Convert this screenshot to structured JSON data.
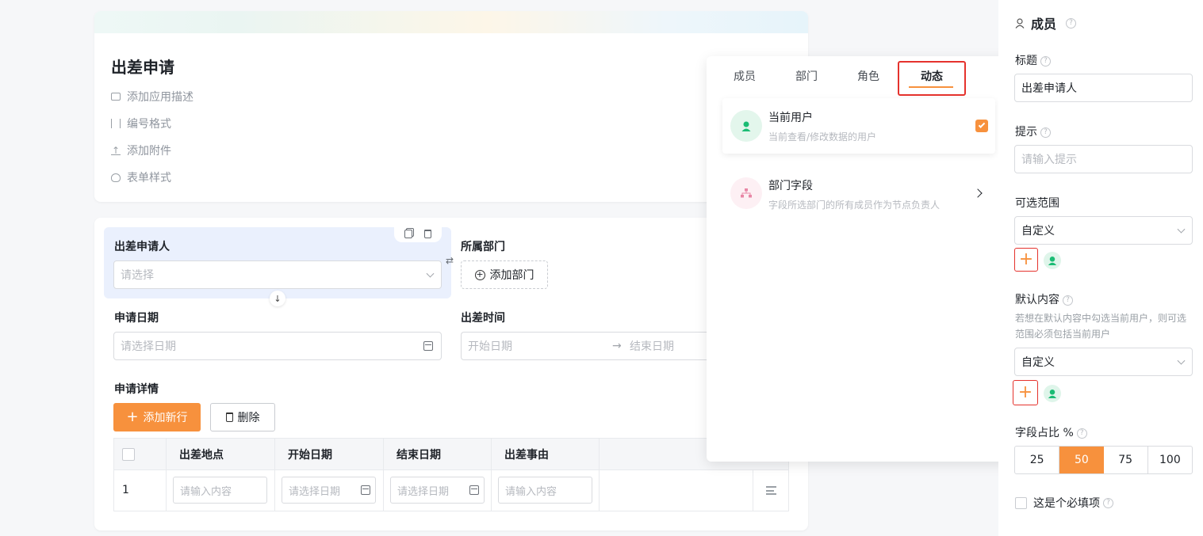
{
  "form": {
    "title": "出差申请",
    "actions": [
      {
        "icon": "comment-icon",
        "label": "添加应用描述"
      },
      {
        "icon": "number-format-icon",
        "label": "编号格式"
      },
      {
        "icon": "upload-icon",
        "label": "添加附件"
      },
      {
        "icon": "palette-icon",
        "label": "表单样式"
      }
    ]
  },
  "fields": {
    "applicant": {
      "label": "出差申请人",
      "placeholder": "请选择"
    },
    "department": {
      "label": "所属部门",
      "button": "添加部门"
    },
    "apply_date": {
      "label": "申请日期",
      "placeholder": "请选择日期"
    },
    "trip_time": {
      "label": "出差时间",
      "start_placeholder": "开始日期",
      "arrow": "→",
      "end_placeholder": "结束日期"
    },
    "details": {
      "label": "申请详情",
      "add_row": "添加新行",
      "delete": "删除",
      "columns": [
        "出差地点",
        "开始日期",
        "结束日期",
        "出差事由"
      ],
      "rows": [
        {
          "index": "1",
          "place": "请输入内容",
          "start": "请选择日期",
          "end": "请选择日期",
          "reason": "请输入内容"
        }
      ]
    }
  },
  "popover": {
    "tabs": [
      "成员",
      "部门",
      "角色",
      "动态"
    ],
    "active_tab": "动态",
    "items": [
      {
        "title": "当前用户",
        "desc": "当前查看/修改数据的用户",
        "checked": true
      },
      {
        "title": "部门字段",
        "desc": "字段所选部门的所有成员作为节点负责人",
        "checked": false
      }
    ]
  },
  "panel": {
    "header": "成员",
    "title_label": "标题",
    "title_value": "出差申请人",
    "hint_label": "提示",
    "hint_placeholder": "请输入提示",
    "range_label": "可选范围",
    "range_value": "自定义",
    "default_label": "默认内容",
    "default_desc": "若想在默认内容中勾选当前用户，则可选范围必须包括当前用户",
    "default_value": "自定义",
    "ratio_label": "字段占比 %",
    "ratio_options": [
      "25",
      "50",
      "75",
      "100"
    ],
    "ratio_selected": "50",
    "required_label": "这是个必填项"
  },
  "colors": {
    "accent": "#f7913d",
    "highlight": "#e5322d",
    "selected_field_bg": "#eaf0fd",
    "avatar_green": "#1bbc74"
  }
}
